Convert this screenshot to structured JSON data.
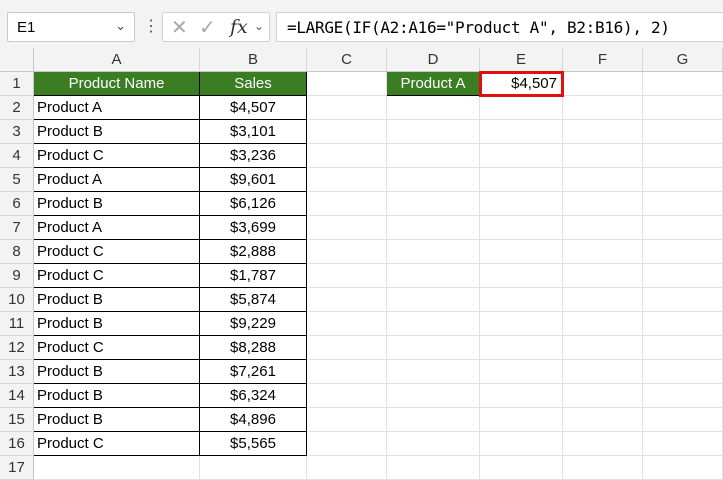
{
  "formula_bar": {
    "name_box": "E1",
    "formula": "=LARGE(IF(A2:A16=\"Product A\", B2:B16), 2)",
    "icons": [
      "chevron-down-icon",
      "more-options-icon",
      "cancel-icon",
      "enter-icon",
      "insert-function-icon"
    ]
  },
  "columns": [
    "A",
    "B",
    "C",
    "D",
    "E",
    "F",
    "G"
  ],
  "rows": [
    "1",
    "2",
    "3",
    "4",
    "5",
    "6",
    "7",
    "8",
    "9",
    "10",
    "11",
    "12",
    "13",
    "14",
    "15",
    "16",
    "17"
  ],
  "table": {
    "headers": [
      "Product Name",
      "Sales"
    ],
    "rows": [
      [
        "Product A",
        "$4,507"
      ],
      [
        "Product B",
        "$3,101"
      ],
      [
        "Product C",
        "$3,236"
      ],
      [
        "Product A",
        "$9,601"
      ],
      [
        "Product B",
        "$6,126"
      ],
      [
        "Product A",
        "$3,699"
      ],
      [
        "Product C",
        "$2,888"
      ],
      [
        "Product C",
        "$1,787"
      ],
      [
        "Product B",
        "$5,874"
      ],
      [
        "Product B",
        "$9,229"
      ],
      [
        "Product C",
        "$8,288"
      ],
      [
        "Product B",
        "$7,261"
      ],
      [
        "Product B",
        "$6,324"
      ],
      [
        "Product B",
        "$4,896"
      ],
      [
        "Product C",
        "$5,565"
      ]
    ]
  },
  "lookup": {
    "label": "Product A",
    "result": "$4,507"
  },
  "colors": {
    "header_green": "#3a7d22",
    "selection_red": "#e01010"
  }
}
